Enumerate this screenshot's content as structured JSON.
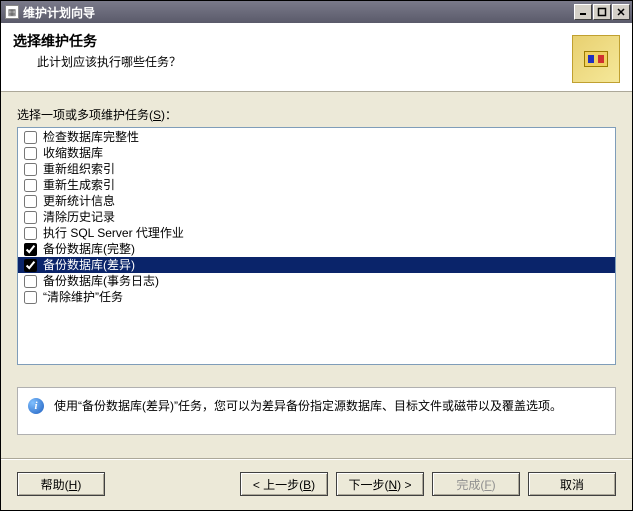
{
  "window": {
    "title": "维护计划向导"
  },
  "header": {
    "title": "选择维护任务",
    "subtitle": "此计划应该执行哪些任务？"
  },
  "listLabel": {
    "pre": "选择一项或多项维护任务(",
    "mn": "S",
    "post": ")："
  },
  "tasks": [
    {
      "label": "检查数据库完整性",
      "checked": false,
      "selected": false
    },
    {
      "label": "收缩数据库",
      "checked": false,
      "selected": false
    },
    {
      "label": "重新组织索引",
      "checked": false,
      "selected": false
    },
    {
      "label": "重新生成索引",
      "checked": false,
      "selected": false
    },
    {
      "label": "更新统计信息",
      "checked": false,
      "selected": false
    },
    {
      "label": "清除历史记录",
      "checked": false,
      "selected": false
    },
    {
      "label": "执行 SQL Server 代理作业",
      "checked": false,
      "selected": false
    },
    {
      "label": "备份数据库(完整)",
      "checked": true,
      "selected": false
    },
    {
      "label": "备份数据库(差异)",
      "checked": true,
      "selected": true
    },
    {
      "label": "备份数据库(事务日志)",
      "checked": false,
      "selected": false
    },
    {
      "label": "“清除维护”任务",
      "checked": false,
      "selected": false
    }
  ],
  "description": "使用“备份数据库(差异)”任务，您可以为差异备份指定源数据库、目标文件或磁带以及覆盖选项。",
  "buttons": {
    "help": {
      "pre": "帮助(",
      "mn": "H",
      "post": ")"
    },
    "back": {
      "pre": "< 上一步(",
      "mn": "B",
      "post": ")"
    },
    "next": {
      "pre": "下一步(",
      "mn": "N",
      "post": ") >"
    },
    "finish": {
      "pre": "完成(",
      "mn": "F",
      "post": ")"
    },
    "cancel": {
      "label": "取消"
    }
  }
}
